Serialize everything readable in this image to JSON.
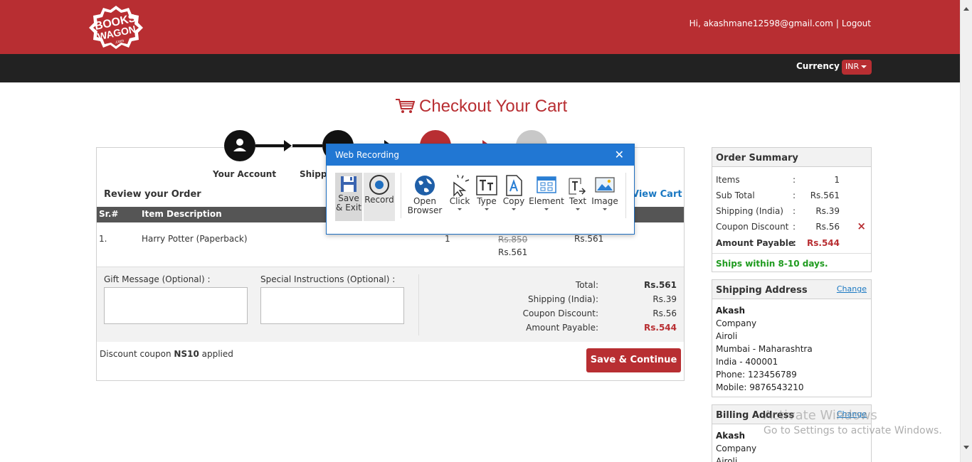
{
  "header": {
    "logo_text": "BOOKS WAGON",
    "logo_sub": ".com",
    "greeting": "Hi, akashmane12598@gmail.com",
    "separator": "|",
    "logout": "Logout",
    "currency_label": "Currency",
    "currency_value": "INR"
  },
  "page_title": "Checkout Your Cart",
  "steps": [
    {
      "label": "Your Account"
    },
    {
      "label": "Shipp"
    }
  ],
  "order": {
    "review_label": "Review your Order",
    "view_cart": "View Cart",
    "columns": {
      "sr": "Sr.#",
      "desc": "Item Description"
    },
    "items": [
      {
        "sr": "1.",
        "description": "Harry Potter (Paperback)",
        "qty": "1",
        "mrp": "Rs.850",
        "price": "Rs.561",
        "total": "Rs.561"
      }
    ],
    "gift_label": "Gift Message (Optional) :",
    "instructions_label": "Special Instructions (Optional) :",
    "totals": [
      {
        "label": "Total:",
        "value": "Rs.561"
      },
      {
        "label": "Shipping (India):",
        "value": "Rs.39"
      },
      {
        "label": "Coupon Discount:",
        "value": "Rs.56"
      },
      {
        "label": "Amount Payable:",
        "value": "Rs.544"
      }
    ],
    "coupon_prefix": "Discount coupon ",
    "coupon_code": "NS10",
    "coupon_suffix": " applied",
    "save_button": "Save & Continue"
  },
  "summary": {
    "title": "Order Summary",
    "rows": [
      {
        "label": "Items",
        "value": "1"
      },
      {
        "label": "Sub Total",
        "value": "Rs.561"
      },
      {
        "label": "Shipping (India)",
        "value": "Rs.39"
      },
      {
        "label": "Coupon Discount",
        "value": "Rs.56"
      },
      {
        "label": "Amount Payable",
        "value": "Rs.544"
      }
    ],
    "colon": ":",
    "remove_mark": "×",
    "ships_note": "Ships within 8-10 days."
  },
  "shipping_address": {
    "title": "Shipping Address",
    "change": "Change",
    "lines": [
      "Akash",
      "Company",
      "Airoli",
      "Mumbai - Maharashtra",
      "India - 400001",
      "Phone: 123456789",
      "Mobile: 9876543210"
    ]
  },
  "billing_address": {
    "title": "Billing Address",
    "change": "Change",
    "lines": [
      "Akash",
      "Company",
      "Airoli"
    ]
  },
  "watermark": {
    "line1": "Activate Windows",
    "line2": "Go to Settings to activate Windows."
  },
  "recorder": {
    "title": "Web Recording",
    "close": "✕",
    "tools": [
      {
        "label1": "Save",
        "label2": "& Exit"
      },
      {
        "label1": "Record",
        "label2": ""
      },
      {
        "label1": "Open",
        "label2": "Browser"
      },
      {
        "label1": "Click",
        "label2": ""
      },
      {
        "label1": "Type",
        "label2": ""
      },
      {
        "label1": "Copy",
        "label2": ""
      },
      {
        "label1": "Element",
        "label2": ""
      },
      {
        "label1": "Text",
        "label2": ""
      },
      {
        "label1": "Image",
        "label2": ""
      }
    ]
  },
  "colors": {
    "brand_red": "#b82e32",
    "dark_bar": "#222222",
    "link_blue": "#1a78c2",
    "ship_green": "#1f9b1f",
    "dialog_blue": "#2177d3"
  }
}
